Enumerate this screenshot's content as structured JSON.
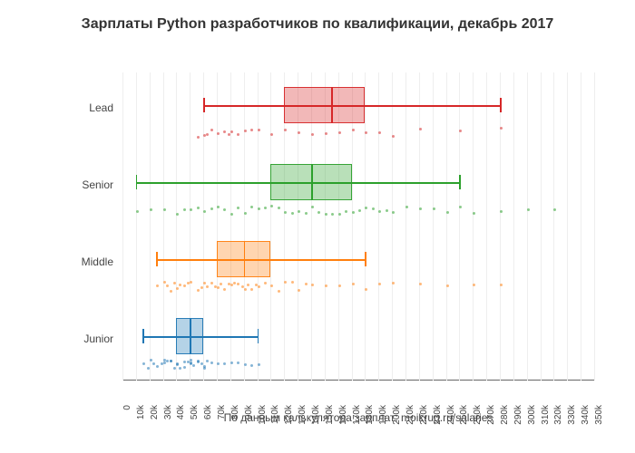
{
  "title": "Зарплаты Python разработчиков по квалификации, декабрь 2017",
  "xlabel": "По данным калькулятора зарплат: moikrug.ru/salaries",
  "chart_data": {
    "type": "box",
    "xlim": [
      0,
      350
    ],
    "xticks": [
      "0",
      "10k",
      "20k",
      "30k",
      "40k",
      "50k",
      "60k",
      "70k",
      "80k",
      "90k",
      "100k",
      "110k",
      "120k",
      "130k",
      "140k",
      "150k",
      "160k",
      "170k",
      "180k",
      "190k",
      "200k",
      "210k",
      "220k",
      "230k",
      "240k",
      "250k",
      "260k",
      "270k",
      "280k",
      "290k",
      "300k",
      "310k",
      "320k",
      "330k",
      "340k",
      "350k"
    ],
    "categories": [
      "Junior",
      "Middle",
      "Senior",
      "Lead"
    ],
    "series": [
      {
        "name": "Junior",
        "color": "#1f77b4",
        "fill": "rgba(31,119,180,0.35)",
        "whisker_low": 15,
        "q1": 40,
        "median": 50,
        "q3": 60,
        "whisker_high": 100,
        "points": [
          15,
          18,
          20,
          22,
          25,
          28,
          30,
          30,
          32,
          35,
          35,
          38,
          40,
          40,
          42,
          45,
          45,
          48,
          50,
          50,
          50,
          52,
          55,
          55,
          58,
          60,
          60,
          62,
          65,
          70,
          75,
          80,
          85,
          90,
          95,
          100
        ]
      },
      {
        "name": "Middle",
        "color": "#ff7f0e",
        "fill": "rgba(255,127,14,0.35)",
        "whisker_low": 25,
        "q1": 70,
        "median": 90,
        "q3": 110,
        "whisker_high": 180,
        "points": [
          25,
          30,
          32,
          35,
          38,
          40,
          42,
          45,
          48,
          50,
          55,
          58,
          60,
          62,
          65,
          68,
          70,
          72,
          75,
          78,
          80,
          82,
          85,
          88,
          90,
          92,
          95,
          98,
          100,
          105,
          110,
          115,
          120,
          125,
          130,
          135,
          140,
          150,
          160,
          170,
          180,
          190,
          200,
          220,
          240,
          260,
          280
        ]
      },
      {
        "name": "Senior",
        "color": "#2ca02c",
        "fill": "rgba(44,160,44,0.35)",
        "whisker_low": 10,
        "q1": 110,
        "median": 140,
        "q3": 170,
        "whisker_high": 250,
        "points": [
          10,
          20,
          30,
          40,
          45,
          50,
          55,
          60,
          65,
          70,
          75,
          80,
          85,
          90,
          95,
          100,
          105,
          110,
          115,
          120,
          125,
          130,
          135,
          140,
          145,
          150,
          155,
          160,
          165,
          170,
          175,
          180,
          185,
          190,
          195,
          200,
          210,
          220,
          230,
          240,
          250,
          260,
          280,
          300,
          320
        ]
      },
      {
        "name": "Lead",
        "color": "#d62728",
        "fill": "rgba(214,39,40,0.35)",
        "whisker_low": 60,
        "q1": 120,
        "median": 155,
        "q3": 180,
        "whisker_high": 280,
        "points": [
          55,
          60,
          62,
          65,
          70,
          75,
          78,
          80,
          85,
          90,
          95,
          100,
          110,
          120,
          130,
          140,
          150,
          160,
          170,
          180,
          190,
          200,
          220,
          250,
          280
        ]
      }
    ]
  }
}
